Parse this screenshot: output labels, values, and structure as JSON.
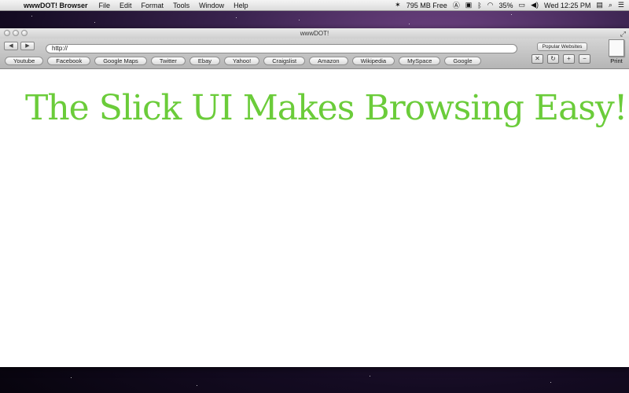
{
  "menubar": {
    "app_name": "wwwDOT! Browser",
    "items": [
      "File",
      "Edit",
      "Format",
      "Tools",
      "Window",
      "Help"
    ],
    "memory": "795 MB Free",
    "battery": "35%",
    "clock": "Wed 12:25 PM"
  },
  "window": {
    "title": "wwwDOT!"
  },
  "toolbar": {
    "url_value": "http://",
    "popular_label": "Popular Websites",
    "print_label": "Print",
    "controls": [
      "✕",
      "↻",
      "+",
      "−"
    ]
  },
  "bookmarks": [
    "Youtube",
    "Facebook",
    "Google Maps",
    "Twitter",
    "Ebay",
    "Yahoo!",
    "Craigslist",
    "Amazon",
    "Wikipedia",
    "MySpace",
    "Google"
  ],
  "content": {
    "headline": "The Slick UI Makes Browsing Easy!"
  },
  "colors": {
    "headline": "#6bcc3a"
  }
}
